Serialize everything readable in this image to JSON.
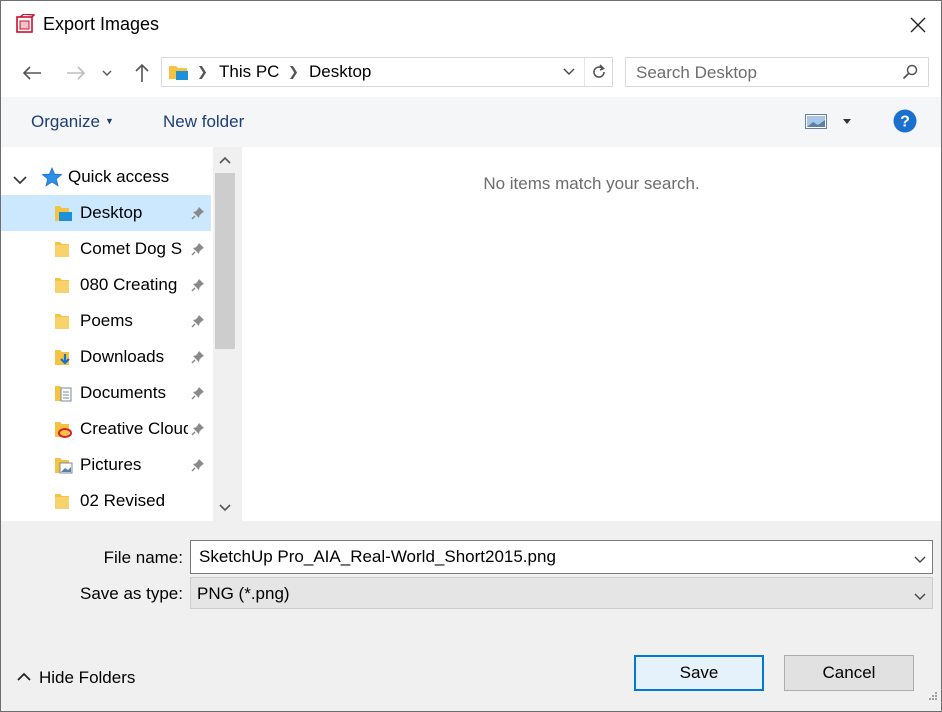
{
  "window": {
    "title": "Export Images"
  },
  "nav": {
    "breadcrumbs": [
      "This PC",
      "Desktop"
    ],
    "search_placeholder": "Search Desktop"
  },
  "toolbar": {
    "organize_label": "Organize",
    "new_folder_label": "New folder"
  },
  "sidebar": {
    "quick_access_label": "Quick access",
    "items": [
      {
        "label": "Desktop",
        "icon": "desktop-folder-icon",
        "pinned": true,
        "selected": true
      },
      {
        "label": "Comet Dog S",
        "icon": "folder-icon",
        "pinned": true
      },
      {
        "label": "080 Creating",
        "icon": "folder-icon",
        "pinned": true
      },
      {
        "label": "Poems",
        "icon": "folder-icon",
        "pinned": true
      },
      {
        "label": "Downloads",
        "icon": "downloads-folder-icon",
        "pinned": true
      },
      {
        "label": "Documents",
        "icon": "documents-folder-icon",
        "pinned": true
      },
      {
        "label": "Creative Cloud",
        "icon": "creative-cloud-folder-icon",
        "pinned": true
      },
      {
        "label": "Pictures",
        "icon": "pictures-folder-icon",
        "pinned": true
      },
      {
        "label": "02 Revised",
        "icon": "folder-icon",
        "pinned": false
      }
    ]
  },
  "content": {
    "empty_message": "No items match your search."
  },
  "form": {
    "file_name_label": "File name:",
    "file_name_value": "SketchUp Pro_AIA_Real-World_Short2015.png",
    "save_type_label": "Save as type:",
    "save_type_value": "PNG (*.png)"
  },
  "footer": {
    "hide_folders_label": "Hide Folders",
    "save_label": "Save",
    "cancel_label": "Cancel"
  },
  "colors": {
    "accent": "#0078d7",
    "selection": "#cce8ff",
    "toolbar_text": "#1e3e78",
    "folder": "#f5c342"
  }
}
